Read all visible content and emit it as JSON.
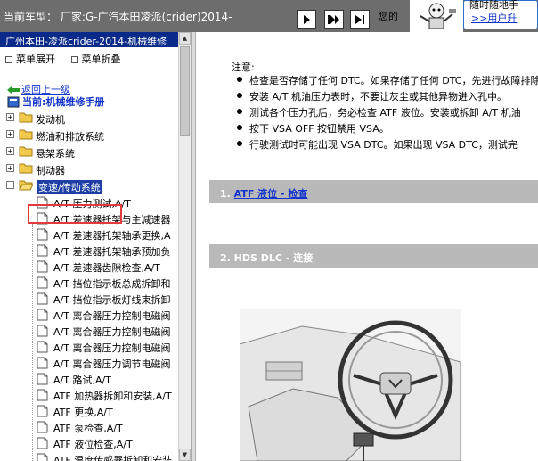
{
  "topbar": {
    "vehicle_text": "当前车型：  厂家:G-广汽本田凌派(crider)2014-",
    "greeting": "您的",
    "user_top": "随时随地手",
    "user_link": ">>用户升",
    "buttons": [
      "play-forward",
      "skip",
      "play-end"
    ]
  },
  "left": {
    "header": "广州本田-凌派crider-2014-机械维修",
    "expand_all": "菜单展开",
    "collapse_all": "菜单折叠",
    "back_link": "返回上一级",
    "current_label": "当前:机械维修手册",
    "categories": [
      "发动机",
      "燃油和排放系统",
      "悬架系统",
      "制动器"
    ],
    "open_category": "变速/传动系统",
    "leaves": [
      "A/T 压力测试,A/T",
      "A/T 差速器托架与主减速器",
      "A/T 差速器托架轴承更换,A",
      "A/T 差速器托架轴承预加负",
      "A/T 差速器齿隙检查,A/T",
      "A/T 挡位指示板总成拆卸和",
      "A/T 挡位指示板灯线束拆卸",
      "A/T 离合器压力控制电磁阀",
      "A/T 离合器压力控制电磁阀",
      "A/T 离合器压力控制电磁阀",
      "A/T 离合器压力调节电磁阀",
      "A/T 路试,A/T",
      "ATF 加热器拆卸和安装,A/T",
      "ATF 更换,A/T",
      "ATF 泵检查,A/T",
      "ATF 液位检查,A/T",
      "ATF 温度传感器拆卸和安装"
    ]
  },
  "content": {
    "notice_title": "注意:",
    "notes": [
      "检查是否存储了任何 DTC。如果存储了任何 DTC，先进行故障排除再予",
      "安装 A/T 机油压力表时，不要让灰尘或其他异物进入孔中。",
      "测试各个压力孔后，务必检查 ATF 液位。安装或拆卸 A/T 机油",
      "按下 VSA OFF 按钮禁用 VSA。",
      "行驶测试时可能出现 VSA DTC。如果出现 VSA DTC，测试完"
    ],
    "section1_prefix": "1. ",
    "section1_link": "ATF 液位 - 检查",
    "section2": "2. HDS DLC - 连接"
  }
}
